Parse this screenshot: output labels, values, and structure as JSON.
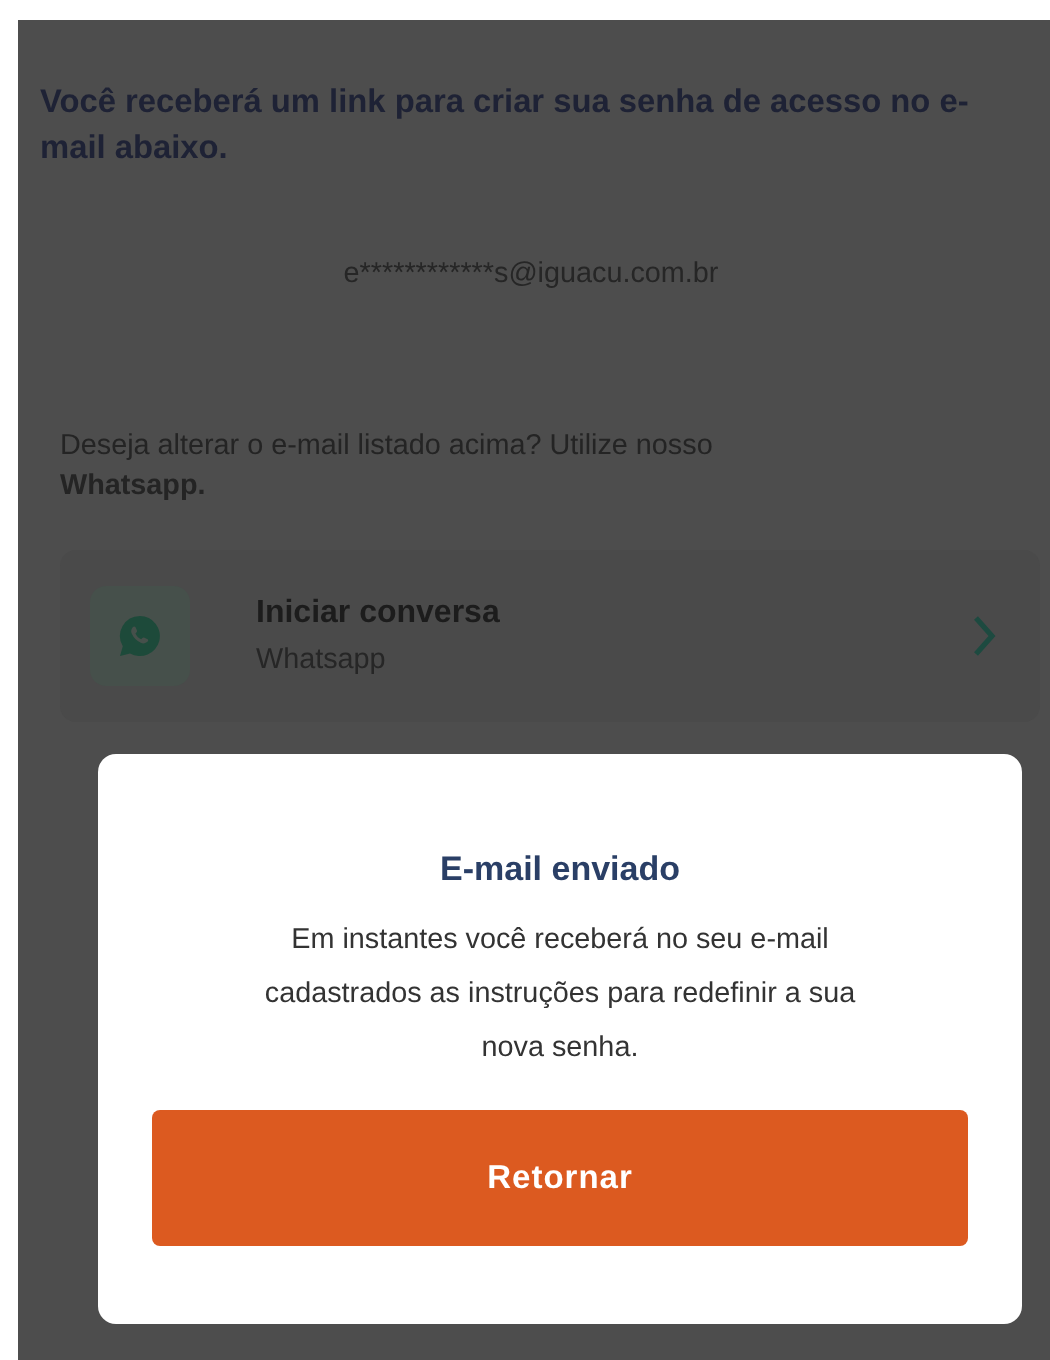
{
  "intro": "Você receberá um link para criar sua senha de acesso no e-mail abaixo.",
  "email": "e************s@iguacu.com.br",
  "change_prompt": "Deseja alterar o e-mail listado acima? Utilize nosso **Whatsapp.**",
  "contact": {
    "title": "Iniciar conversa",
    "subtitle": "Whatsapp"
  },
  "dialog": {
    "title": "E-mail enviado",
    "message": "Em instantes você receberá no seu e-mail cadastrados as instruções para redefinir a sua nova senha.",
    "button": "Retornar"
  }
}
